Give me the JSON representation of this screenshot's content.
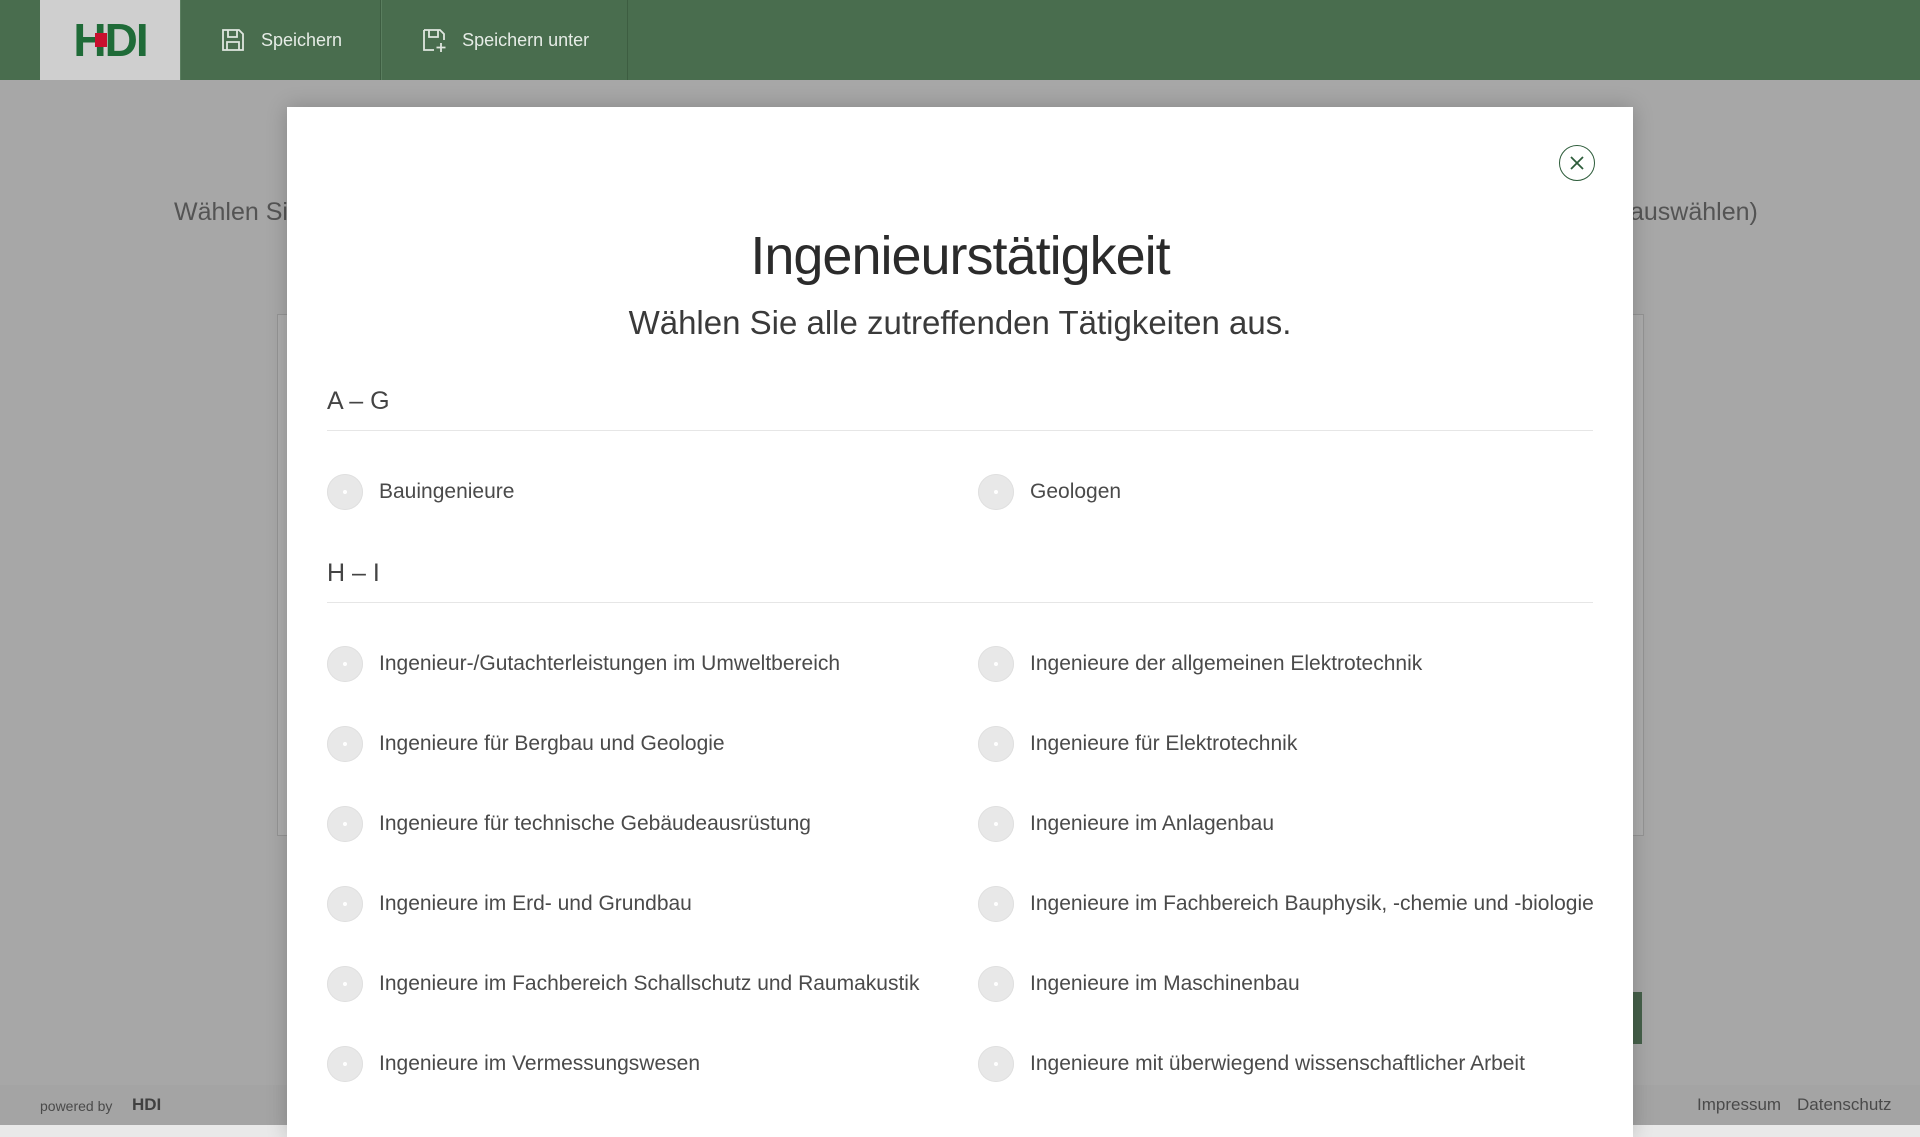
{
  "topbar": {
    "logo": "HDI",
    "save_label": "Speichern",
    "save_as_label": "Speichern unter"
  },
  "background": {
    "left_text": "Wählen Sie",
    "right_text": "auswählen)"
  },
  "footer": {
    "powered_by": "powered by",
    "powered_logo": "HDI",
    "impressum": "Impressum",
    "datenschutz": "Datenschutz"
  },
  "modal": {
    "title": "Ingenieurstätigkeit",
    "subtitle": "Wählen Sie alle zutreffenden Tätigkeiten aus.",
    "sections": [
      {
        "heading": "A – G",
        "options": [
          "Bauingenieure",
          "Geologen"
        ]
      },
      {
        "heading": "H – I",
        "options": [
          "Ingenieur-/Gutachterleistungen im Umweltbereich",
          "Ingenieure der allgemeinen Elektrotechnik",
          "Ingenieure für Bergbau und Geologie",
          "Ingenieure für Elektrotechnik",
          "Ingenieure für technische Gebäudeausrüstung",
          "Ingenieure im Anlagenbau",
          "Ingenieure im Erd- und Grundbau",
          "Ingenieure im Fachbereich Bauphysik, -chemie und -biologie",
          "Ingenieure im Fachbereich Schallschutz und Raumakustik",
          "Ingenieure im Maschinenbau",
          "Ingenieure im Vermessungswesen",
          "Ingenieure mit überwiegend wissenschaftlicher Arbeit"
        ]
      }
    ]
  },
  "colors": {
    "topbar": "#496d4e",
    "brand_green": "#1f6b38",
    "brand_red": "#c8102e"
  }
}
